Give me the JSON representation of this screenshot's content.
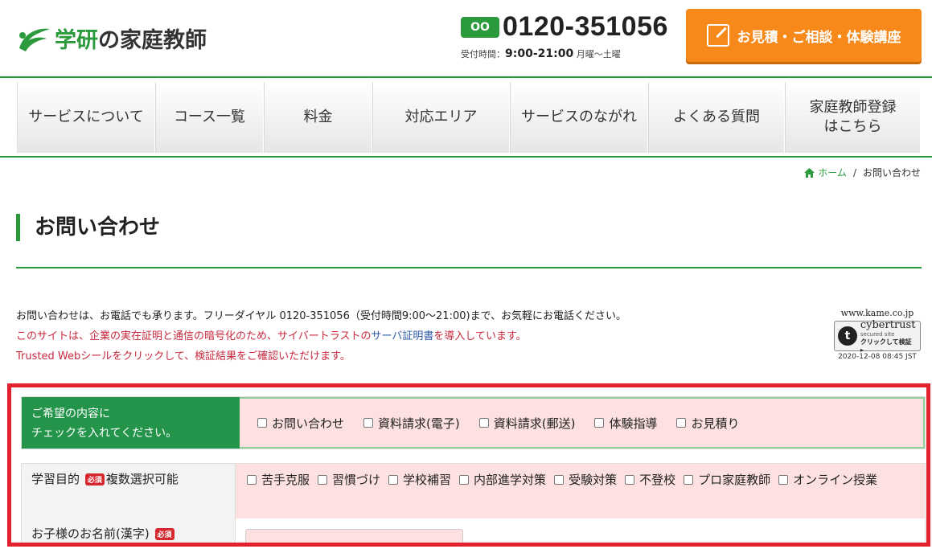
{
  "header": {
    "logo_text_main": "学研",
    "logo_text_rest": "の家庭教師",
    "freedial_label": "OO",
    "phone": "0120-351056",
    "hours_label": "受付時間：",
    "hours_time": "9:00-21:00",
    "hours_days": " 月曜～土曜",
    "cta_label": "お見積・ご相談・体験講座"
  },
  "nav": {
    "items": [
      {
        "label": "サービスについて"
      },
      {
        "label": "コース一覧"
      },
      {
        "label": "料金"
      },
      {
        "label": "対応エリア"
      },
      {
        "label": "サービスのながれ"
      },
      {
        "label": "よくある質問"
      },
      {
        "label": "家庭教師登録\nはこちら"
      }
    ]
  },
  "breadcrumb": {
    "home": "ホーム",
    "separator": "/",
    "current": "お問い合わせ"
  },
  "page": {
    "title": "お問い合わせ"
  },
  "intro": {
    "line1": "お問い合わせは、お電話でも承ります。フリーダイヤル 0120-351056（受付時間9:00～21:00)まで、お気軽にお電話ください。",
    "line2_a": "このサイトは、企業の実在証明と通信の暗号化のため、サイバートラストの",
    "line2_link": "サーバ証明書",
    "line2_b": "を導入しています。",
    "line3": "Trusted Webシールをクリックして、検証結果をご確認いただけます。"
  },
  "seal": {
    "url": "www.kame.co.jp",
    "brand": "cybertrust",
    "sub": "secured site",
    "click": "クリックして検証 ▸",
    "date": "2020-12-08 08:45 JST"
  },
  "form": {
    "row1_label_line1": "ご希望の内容に",
    "row1_label_line2": "チェックを入れてください。",
    "row1_options": [
      "お問い合わせ",
      "資料請求(電子)",
      "資料請求(郵送)",
      "体験指導",
      "お見積り"
    ],
    "row2_label": "学習目的",
    "row2_required": "必須",
    "row2_suffix": "複数選択可能",
    "row2_options": [
      "苦手克服",
      "習慣づけ",
      "学校補習",
      "内部進学対策",
      "受験対策",
      "不登校",
      "プロ家庭教師",
      "オンライン授業"
    ],
    "row3_label": "お子様のお名前(漢字)",
    "row3_required": "必須",
    "row3_value": ""
  },
  "colors": {
    "brand_green": "#2a9a3c",
    "cta_orange": "#f7881a",
    "highlight_red": "#e3202e"
  }
}
